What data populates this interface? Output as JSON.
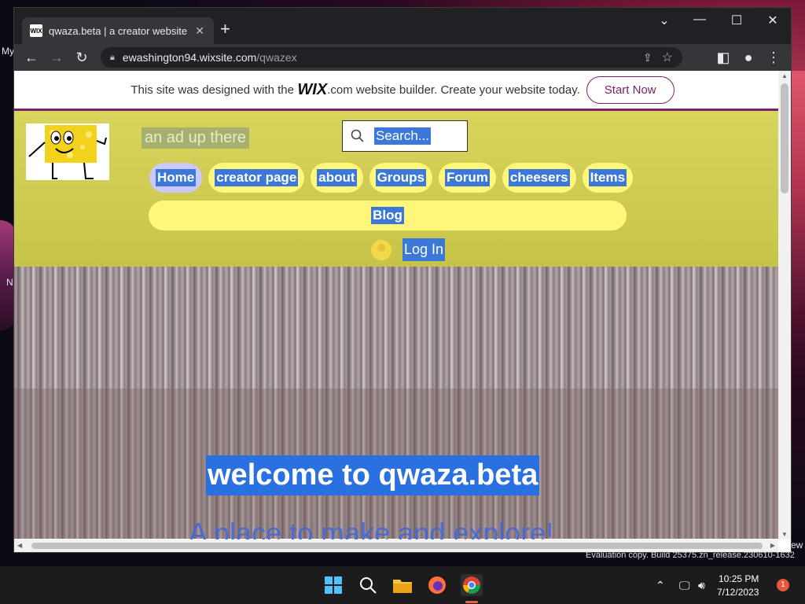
{
  "desktop": {
    "frag_left_top": "My",
    "frag_left_mid": "N",
    "frag_right": "ew"
  },
  "browser": {
    "tab_title": "qwaza.beta | a creator website",
    "favicon_text": "WIX",
    "new_tab_label": "+",
    "url_host": "ewashington94.wixsite.com",
    "url_path": "/qwazex"
  },
  "wix_banner": {
    "text_before": "This site was designed with the",
    "logo_text": "WIX",
    "text_after": ".com website builder. Create your website today.",
    "cta": "Start Now"
  },
  "site": {
    "ad_text": "an ad up there",
    "search_placeholder": "Search...",
    "nav": [
      {
        "label": "Home",
        "active": true
      },
      {
        "label": "creator page"
      },
      {
        "label": "about"
      },
      {
        "label": "Groups"
      },
      {
        "label": "Forum"
      },
      {
        "label": "cheesers"
      },
      {
        "label": "Items"
      }
    ],
    "blog_label": "Blog",
    "login_label": "Log In",
    "hero_title": "welcome to qwaza.beta",
    "hero_subtitle": "A place to make and explore!"
  },
  "watermark": "Evaluation copy. Build 25375.zn_release.230610-1632",
  "taskbar": {
    "time": "10:25 PM",
    "date": "7/12/2023",
    "notification_count": "1"
  },
  "colors": {
    "nav_pill": "#fff67a",
    "nav_active": "#c9c9ff",
    "header_bg": "#d8d45c",
    "selection": "#3b78d8",
    "wix_accent": "#7b1f6c"
  }
}
